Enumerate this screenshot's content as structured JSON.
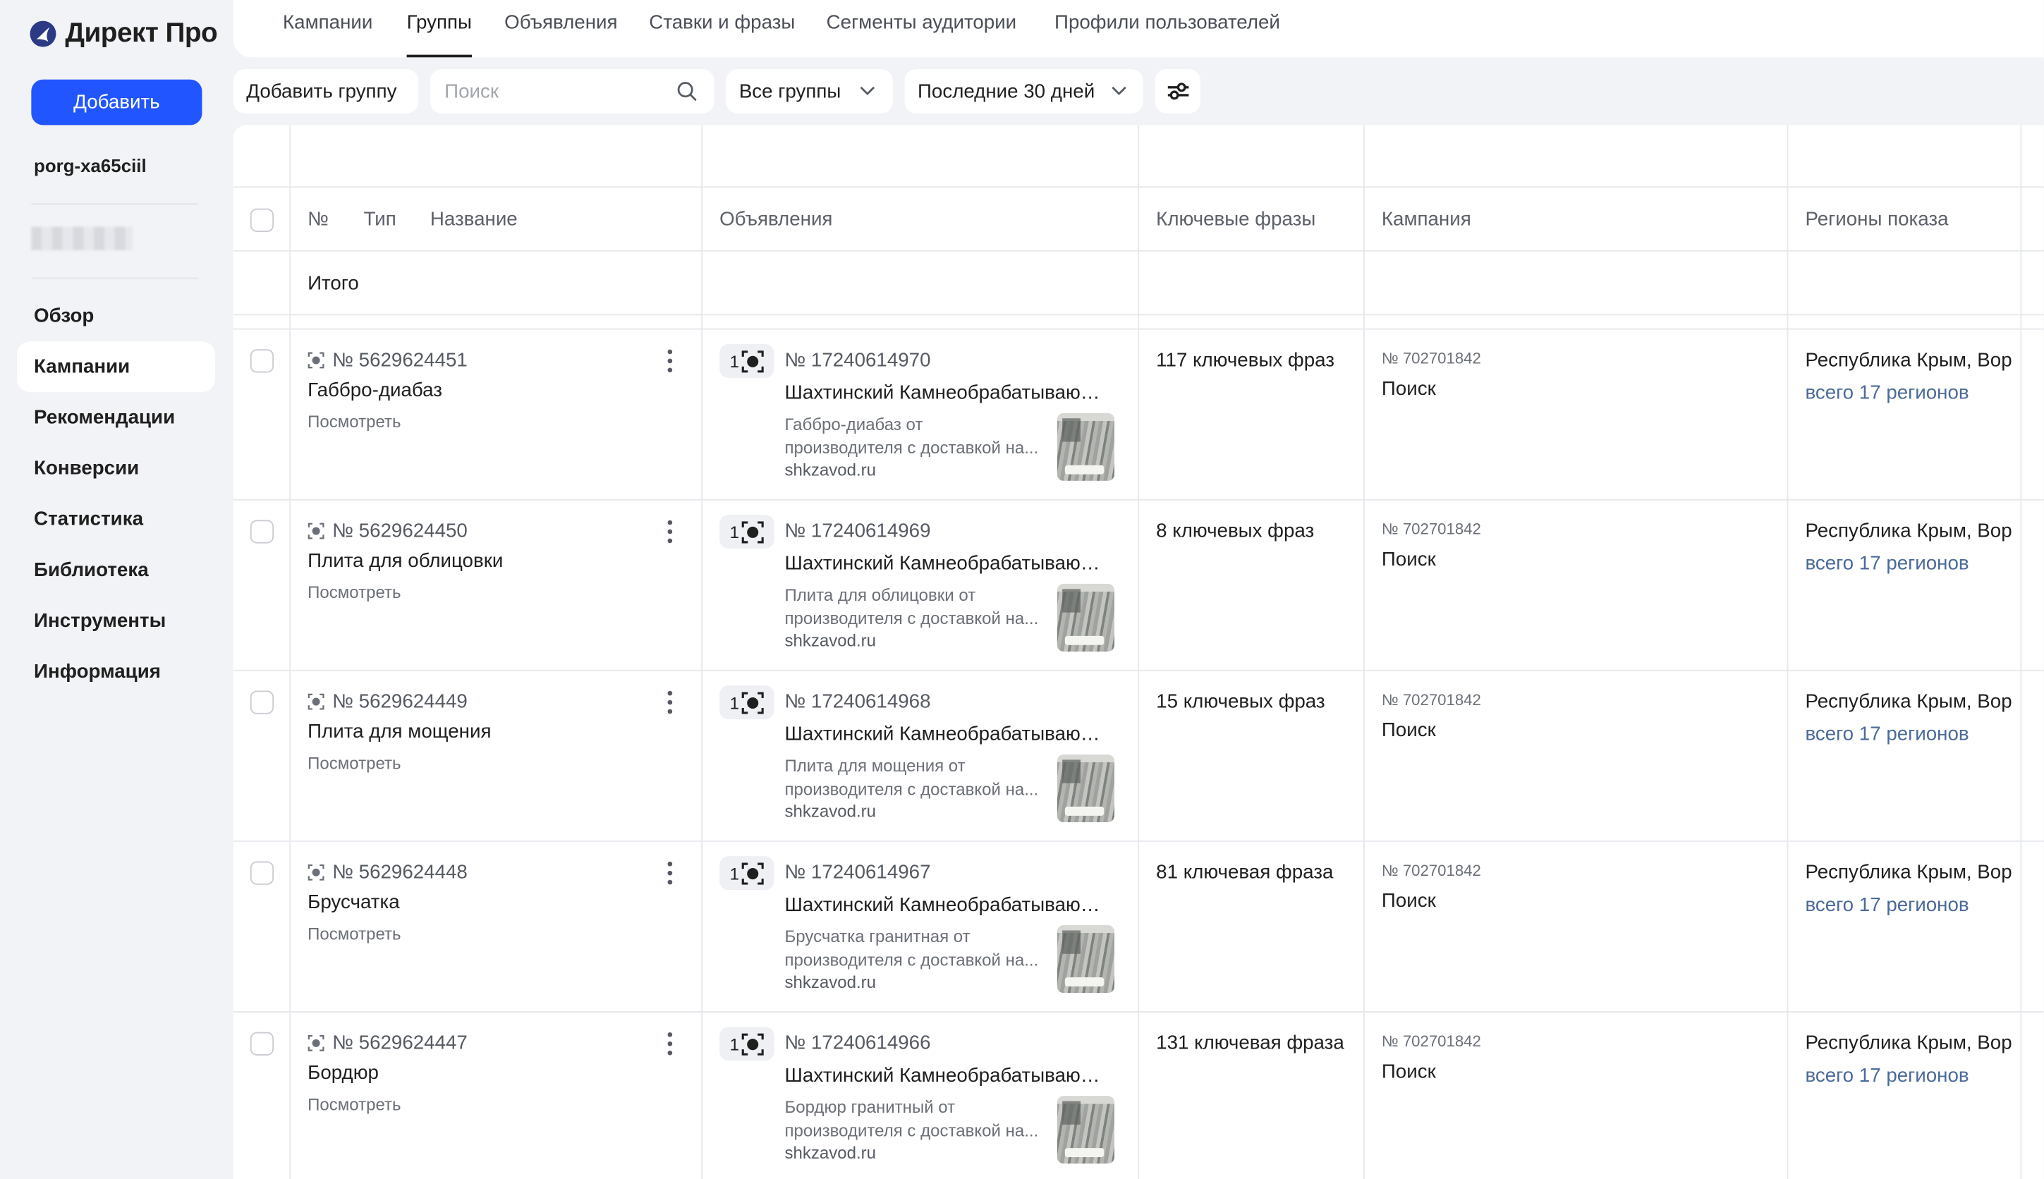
{
  "app": {
    "logo_text": "Директ Про"
  },
  "sidebar": {
    "add_label": "Добавить",
    "account": "porg-xa65ciil",
    "items": [
      {
        "label": "Обзор",
        "active": false
      },
      {
        "label": "Кампании",
        "active": true
      },
      {
        "label": "Рекомендации",
        "active": false
      },
      {
        "label": "Конверсии",
        "active": false
      },
      {
        "label": "Статистика",
        "active": false
      },
      {
        "label": "Библиотека",
        "active": false
      },
      {
        "label": "Инструменты",
        "active": false
      },
      {
        "label": "Информация",
        "active": false
      }
    ]
  },
  "tabs": [
    {
      "label": "Кампании",
      "active": false
    },
    {
      "label": "Группы",
      "active": true
    },
    {
      "label": "Объявления",
      "active": false
    },
    {
      "label": "Ставки и фразы",
      "active": false
    },
    {
      "label": "Сегменты аудитории",
      "active": false
    },
    {
      "label": "Профили пользователей",
      "active": false
    }
  ],
  "toolbar": {
    "add_group": "Добавить группу",
    "search_placeholder": "Поиск",
    "filter_groups": "Все группы",
    "period": "Последние 30 дней"
  },
  "table": {
    "headers": {
      "num": "№",
      "type": "Тип",
      "name": "Название",
      "ads": "Объявления",
      "keywords": "Ключевые фразы",
      "campaign": "Кампания",
      "regions": "Регионы показа"
    },
    "total_label": "Итого",
    "rows": [
      {
        "group_id": "№ 5629624451",
        "name": "Габбро-диабаз",
        "view": "Посмотреть",
        "ad_count": "1",
        "ad_id": "№ 17240614970",
        "ad_title": "Шахтинский Камнеобрабатывающий завод",
        "ad_desc_1": "Габбро-диабаз от",
        "ad_desc_2": "производителя с доставкой на...",
        "ad_domain": "shkzavod.ru",
        "keywords": "117 ключевых фраз",
        "campaign_id": "№ 702701842",
        "campaign_type": "Поиск",
        "regions": "Республика Крым, Вор",
        "regions_total": "всего 17 регионов"
      },
      {
        "group_id": "№ 5629624450",
        "name": "Плита для облицовки",
        "view": "Посмотреть",
        "ad_count": "1",
        "ad_id": "№ 17240614969",
        "ad_title": "Шахтинский Камнеобрабатывающий завод",
        "ad_desc_1": "Плита для облицовки от",
        "ad_desc_2": "производителя с доставкой на...",
        "ad_domain": "shkzavod.ru",
        "keywords": "8 ключевых фраз",
        "campaign_id": "№ 702701842",
        "campaign_type": "Поиск",
        "regions": "Республика Крым, Вор",
        "regions_total": "всего 17 регионов"
      },
      {
        "group_id": "№ 5629624449",
        "name": "Плита для мощения",
        "view": "Посмотреть",
        "ad_count": "1",
        "ad_id": "№ 17240614968",
        "ad_title": "Шахтинский Камнеобрабатывающий завод",
        "ad_desc_1": "Плита для мощения от",
        "ad_desc_2": "производителя с доставкой на...",
        "ad_domain": "shkzavod.ru",
        "keywords": "15 ключевых фраз",
        "campaign_id": "№ 702701842",
        "campaign_type": "Поиск",
        "regions": "Республика Крым, Вор",
        "regions_total": "всего 17 регионов"
      },
      {
        "group_id": "№ 5629624448",
        "name": "Брусчатка",
        "view": "Посмотреть",
        "ad_count": "1",
        "ad_id": "№ 17240614967",
        "ad_title": "Шахтинский Камнеобрабатывающий завод",
        "ad_desc_1": "Брусчатка гранитная от",
        "ad_desc_2": "производителя с доставкой на...",
        "ad_domain": "shkzavod.ru",
        "keywords": "81 ключевая фраза",
        "campaign_id": "№ 702701842",
        "campaign_type": "Поиск",
        "regions": "Республика Крым, Вор",
        "regions_total": "всего 17 регионов"
      },
      {
        "group_id": "№ 5629624447",
        "name": "Бордюр",
        "view": "Посмотреть",
        "ad_count": "1",
        "ad_id": "№ 17240614966",
        "ad_title": "Шахтинский Камнеобрабатывающий завод",
        "ad_desc_1": "Бордюр гранитный от",
        "ad_desc_2": "производителя с доставкой на...",
        "ad_domain": "shkzavod.ru",
        "keywords": "131 ключевая фраза",
        "campaign_id": "№ 702701842",
        "campaign_type": "Поиск",
        "regions": "Республика Крым, Вор",
        "regions_total": "всего 17 регионов"
      }
    ]
  },
  "colors": {
    "accent": "#2155ff",
    "link": "#4a6a9a",
    "background": "#f2f3f6"
  }
}
